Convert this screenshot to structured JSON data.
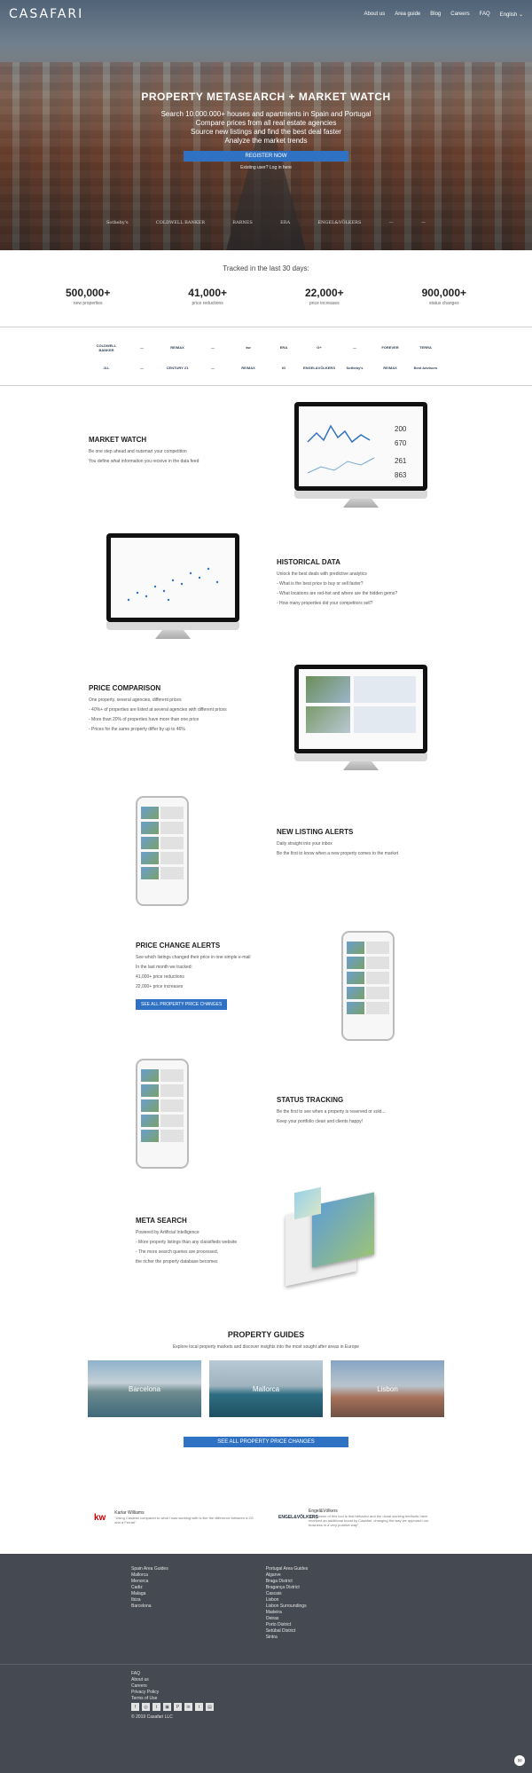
{
  "brand": {
    "logo": "CASAFARI",
    "accent": "#2f72c4"
  },
  "nav": {
    "items": [
      "About us",
      "Area guide",
      "Blog",
      "Careers",
      "FAQ",
      "English ⌄"
    ]
  },
  "hero": {
    "title": "PROPERTY METASEARCH + MARKET WATCH",
    "lines": [
      "Search 10.000.000+ houses and apartments in Spain and Portugal",
      "Compare prices from all real estate agencies",
      "Source new listings and find the best deal faster",
      "Analyze the market trends"
    ],
    "register_label": "REGISTER NOW",
    "login_text": "Existing user? Log in here",
    "agency_logos": [
      "Sotheby's",
      "COLDWELL BANKER",
      "BARNES",
      "ERA",
      "ENGEL&VÖLKERS",
      "—",
      "—"
    ]
  },
  "tracked": {
    "title": "Tracked in the last 30 days:",
    "stats": [
      {
        "value": "500,000+",
        "label": "new properties"
      },
      {
        "value": "41,000+",
        "label": "price reductions"
      },
      {
        "value": "22,000+",
        "label": "price increases"
      },
      {
        "value": "900,000+",
        "label": "status changes"
      }
    ]
  },
  "partners": [
    "COLDWELL BANKER",
    "—",
    "RE/MAX",
    "—",
    "kw",
    "ERA",
    "G+",
    "—",
    "FOREVER",
    "TERRA",
    "JLL",
    "—",
    "CENTURY 21",
    "—",
    "RE/MAX",
    "IG",
    "ENGEL&VÖLKERS",
    "Sotheby's",
    "RE/MAX",
    "Best Advisors"
  ],
  "features": [
    {
      "title": "MARKET WATCH",
      "lines": [
        "Be one step ahead and outsmart your competition",
        "You define what information you receive in the data feed"
      ]
    },
    {
      "title": "HISTORICAL DATA",
      "lines": [
        "Unlock the best deals with predictive analytics",
        "- What is the best price to buy or sell faster?",
        "- What locations are red-hot and where are the hidden gems?",
        "- How many properties did your competitors sell?"
      ]
    },
    {
      "title": "PRICE COMPARISON",
      "lines": [
        "One property, several agencies, different prices",
        "- 40%+ of properties are listed at several agencies with different prices",
        "- More than 20% of properties have more than one price",
        "- Prices for the same property differ by up to 46%"
      ]
    },
    {
      "title": "NEW LISTING ALERTS",
      "lines": [
        "Daily straight into your inbox",
        "Be the first to know when a new property comes to the market"
      ]
    },
    {
      "title": "PRICE CHANGE ALERTS",
      "lines": [
        "See which listings changed their price in one simple e-mail",
        "In the last month we tracked:",
        "41,000+ price reductions",
        "22,000+ price increases"
      ],
      "button": "SEE ALL PROPERTY PRICE CHANGES"
    },
    {
      "title": "STATUS TRACKING",
      "lines": [
        "Be the first to see when a property is reserved or sold...",
        "Keep your portfolio clean and clients happy!"
      ]
    },
    {
      "title": "META SEARCH",
      "lines": [
        "Powered by Artificial Intelligence",
        "- More property listings than any classifieds website",
        "- The more search queries are processed,",
        "the richer the property database becomes"
      ]
    }
  ],
  "screen_stats": {
    "a": "200",
    "b": "670",
    "c": "261",
    "d": "863"
  },
  "guides": {
    "title": "PROPERTY GUIDES",
    "subtitle": "Explore local property markets and discover insights into the most sought after areas in Europe",
    "cities": [
      "Barcelona",
      "Mallorca",
      "Lisbon"
    ],
    "button": "SEE ALL PROPERTY PRICE CHANGES"
  },
  "reviews": [
    {
      "mark": "kw",
      "who": "Karlar Williams",
      "quote": "\"Using Casafari compared to what I was working with is like the difference between a 2G and a Ferrari\""
    },
    {
      "mark": "ENGEL&VÖLKERS",
      "who": "Engel&Völkers",
      "quote": "\"The power of this tool is that behavior and the usual working methods have received an additional boost by Casafari, changing the way we approach our business in a very positive way\""
    }
  ],
  "footer": {
    "col1": [
      "Spain Area Guides",
      "Mallorca",
      "Menorca",
      "Cadiz",
      "Malaga",
      "Ibiza",
      "Barcelona"
    ],
    "col2": [
      "Portugal Area Guides",
      "Algarve",
      "Braga District",
      "Bragança District",
      "Cascais",
      "Lisbon",
      "Lisbon Surroundings",
      "Madeira",
      "Oeiras",
      "Porto District",
      "Setúbal District",
      "Sintra"
    ],
    "links": [
      "FAQ",
      "About us",
      "Careers",
      "Privacy Policy",
      "Terms of Use"
    ],
    "social": [
      "f",
      "◎",
      "t",
      "▣",
      "P",
      "in",
      "t",
      "▤"
    ],
    "copyright": "© 2019 Casafari LLC"
  }
}
